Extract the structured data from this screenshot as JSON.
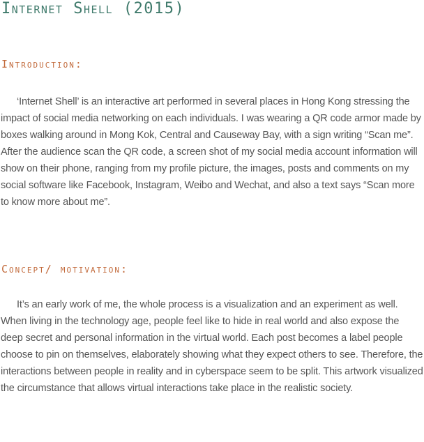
{
  "page": {
    "title": "Internet Shell (2015)"
  },
  "sections": [
    {
      "heading": "Introduction:",
      "body": "‘Internet Shell’ is an interactive art performed in several places in Hong Kong stressing the impact of social media networking on each individuals. I was wearing a QR code armor made by boxes walking around in Mong Kok, Central and Causeway Bay, with a sign writing “Scan me”. After the audience scan the QR code, a screen shot of my social media account information will show on their phone, ranging from my profile picture, the images, posts and comments on my social software like Facebook, Instagram, Weibo and Wechat, and also a text says “Scan more to know more about me”."
    },
    {
      "heading": "Concept/ motivation:",
      "body": "It’s an early work of me, the whole process is a visualization and an experiment as well. When living in the technology age, people feel like to hide in real world and also expose the deep secret and personal information in the virtual world. Each post becomes a label people choose to pin on themselves, elaborately showing what they expect others to see. Therefore, the interactions between people in reality and in cyberspace seem to be split. This artwork visualized the circumstance that allows virtual interactions take place in the realistic society."
    }
  ],
  "colors": {
    "title": "#3f7a6b",
    "heading": "#c26a3b",
    "body_text": "#555555",
    "background": "#ffffff"
  }
}
